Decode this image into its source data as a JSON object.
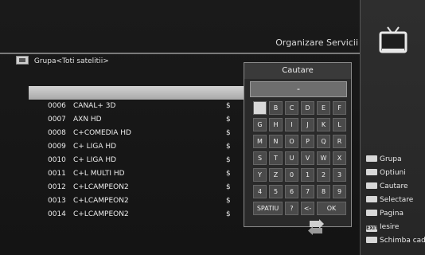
{
  "header": {
    "title": "Organizare Servicii"
  },
  "group": {
    "label": "Grupa<Toti satelitii>"
  },
  "list": {
    "selected_index": 0,
    "rows": [
      {
        "num": "",
        "name": "",
        "sym": ""
      },
      {
        "num": "0006",
        "name": "CANAL+ 3D",
        "sym": "$"
      },
      {
        "num": "0007",
        "name": "AXN HD",
        "sym": "$"
      },
      {
        "num": "0008",
        "name": "C+COMEDIA HD",
        "sym": "$"
      },
      {
        "num": "0009",
        "name": "C+ LIGA HD",
        "sym": "$"
      },
      {
        "num": "0010",
        "name": "C+ LIGA HD",
        "sym": "$"
      },
      {
        "num": "0011",
        "name": "C+L MULTI HD",
        "sym": "$"
      },
      {
        "num": "0012",
        "name": "C+LCAMPEON2",
        "sym": "$"
      },
      {
        "num": "0013",
        "name": "C+LCAMPEON2",
        "sym": "$"
      },
      {
        "num": "0014",
        "name": "C+LCAMPEON2",
        "sym": "$"
      }
    ]
  },
  "search": {
    "title": "Cautare",
    "input_value": "-",
    "keys": [
      [
        "",
        "B",
        "C",
        "D",
        "E",
        "F"
      ],
      [
        "G",
        "H",
        "I",
        "J",
        "K",
        "L"
      ],
      [
        "M",
        "N",
        "O",
        "P",
        "Q",
        "R"
      ],
      [
        "S",
        "T",
        "U",
        "V",
        "W",
        "X"
      ],
      [
        "Y",
        "Z",
        "0",
        "1",
        "2",
        "3"
      ],
      [
        "4",
        "5",
        "6",
        "7",
        "8",
        "9"
      ]
    ],
    "bottom": {
      "space": "SPATIU",
      "question": "?",
      "back": "<-",
      "ok": "OK"
    }
  },
  "legend": [
    {
      "key": "",
      "label": "Grupa",
      "icon": "red-key-icon"
    },
    {
      "key": "",
      "label": "Optiuni",
      "icon": "green-key-icon"
    },
    {
      "key": "",
      "label": "Cautare",
      "icon": "search-key-icon"
    },
    {
      "key": "",
      "label": "Selectare",
      "icon": "select-key-icon"
    },
    {
      "key": "",
      "label": "Pagina",
      "icon": "page-key-icon"
    },
    {
      "key": "EXIT",
      "label": "Iesire",
      "icon": "exit-key-icon"
    },
    {
      "key": "",
      "label": "Schimba cad",
      "icon": "switch-key-icon"
    }
  ]
}
